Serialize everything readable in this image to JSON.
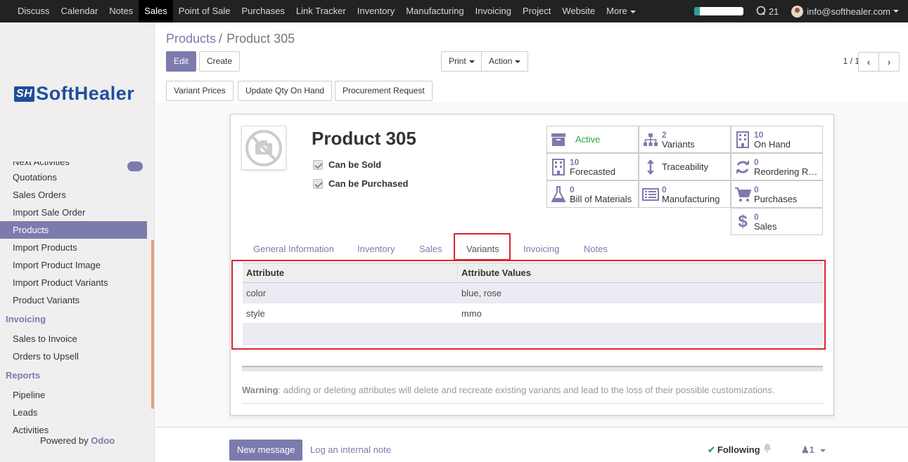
{
  "topbar": {
    "menu": [
      "Discuss",
      "Calendar",
      "Notes",
      "Sales",
      "Point of Sale",
      "Purchases",
      "Link Tracker",
      "Inventory",
      "Manufacturing",
      "Invoicing",
      "Project",
      "Website"
    ],
    "more": "More",
    "chat_count": "21",
    "user_email": "info@softhealer.com",
    "progress": 0.12
  },
  "sidebar": {
    "logo_mark": "SH",
    "logo_text": "SoftHealer",
    "partial_item": "Next Activities",
    "sales_items": [
      "Quotations",
      "Sales Orders",
      "Import Sale Order",
      "Products",
      "Import Products",
      "Import Product Image",
      "Import Product Variants",
      "Product Variants"
    ],
    "invoicing_head": "Invoicing",
    "invoicing_items": [
      "Sales to Invoice",
      "Orders to Upsell"
    ],
    "reports_head": "Reports",
    "reports_items": [
      "Pipeline",
      "Leads",
      "Activities"
    ],
    "powered_prefix": "Powered by",
    "powered_brand": "Odoo"
  },
  "control": {
    "breadcrumb_link": "Products",
    "breadcrumb_sep": "/",
    "breadcrumb_current": "Product 305",
    "edit": "Edit",
    "create": "Create",
    "print": "Print",
    "action": "Action",
    "pager": "1 / 1"
  },
  "header_buttons": [
    "Variant Prices",
    "Update Qty On Hand",
    "Procurement Request"
  ],
  "product": {
    "name": "Product 305",
    "can_be_sold": "Can be Sold",
    "can_be_purchased": "Can be Purchased"
  },
  "smart_buttons": {
    "active": "Active",
    "variants_num": "2",
    "variants": "Variants",
    "onhand_num": "10",
    "onhand": "On Hand",
    "forecasted_num": "10",
    "forecasted": "Forecasted",
    "traceability": "Traceability",
    "reordering_num": "0",
    "reordering": "Reordering R…",
    "bom_num": "0",
    "bom": "Bill of Materials",
    "manufacturing_num": "0",
    "manufacturing": "Manufacturing",
    "purchases_num": "0",
    "purchases": "Purchases",
    "sales_num": "0",
    "sales": "Sales"
  },
  "tabs": [
    "General Information",
    "Inventory",
    "Sales",
    "Variants",
    "Invoicing",
    "Notes"
  ],
  "table": {
    "headers": [
      "Attribute",
      "Attribute Values"
    ],
    "rows": [
      [
        "color",
        "blue, rose"
      ],
      [
        "style",
        "mmo"
      ]
    ]
  },
  "warning": {
    "label": "Warning",
    "text": ": adding or deleting attributes will delete and recreate existing variants and lead to the loss of their possible customizations."
  },
  "chatter": {
    "new_message": "New message",
    "log_note": "Log an internal note",
    "following": "Following",
    "followers": "1"
  },
  "colors": {
    "brand": "#7c7bad",
    "highlight": "#d9262c",
    "topbar": "#222222"
  }
}
